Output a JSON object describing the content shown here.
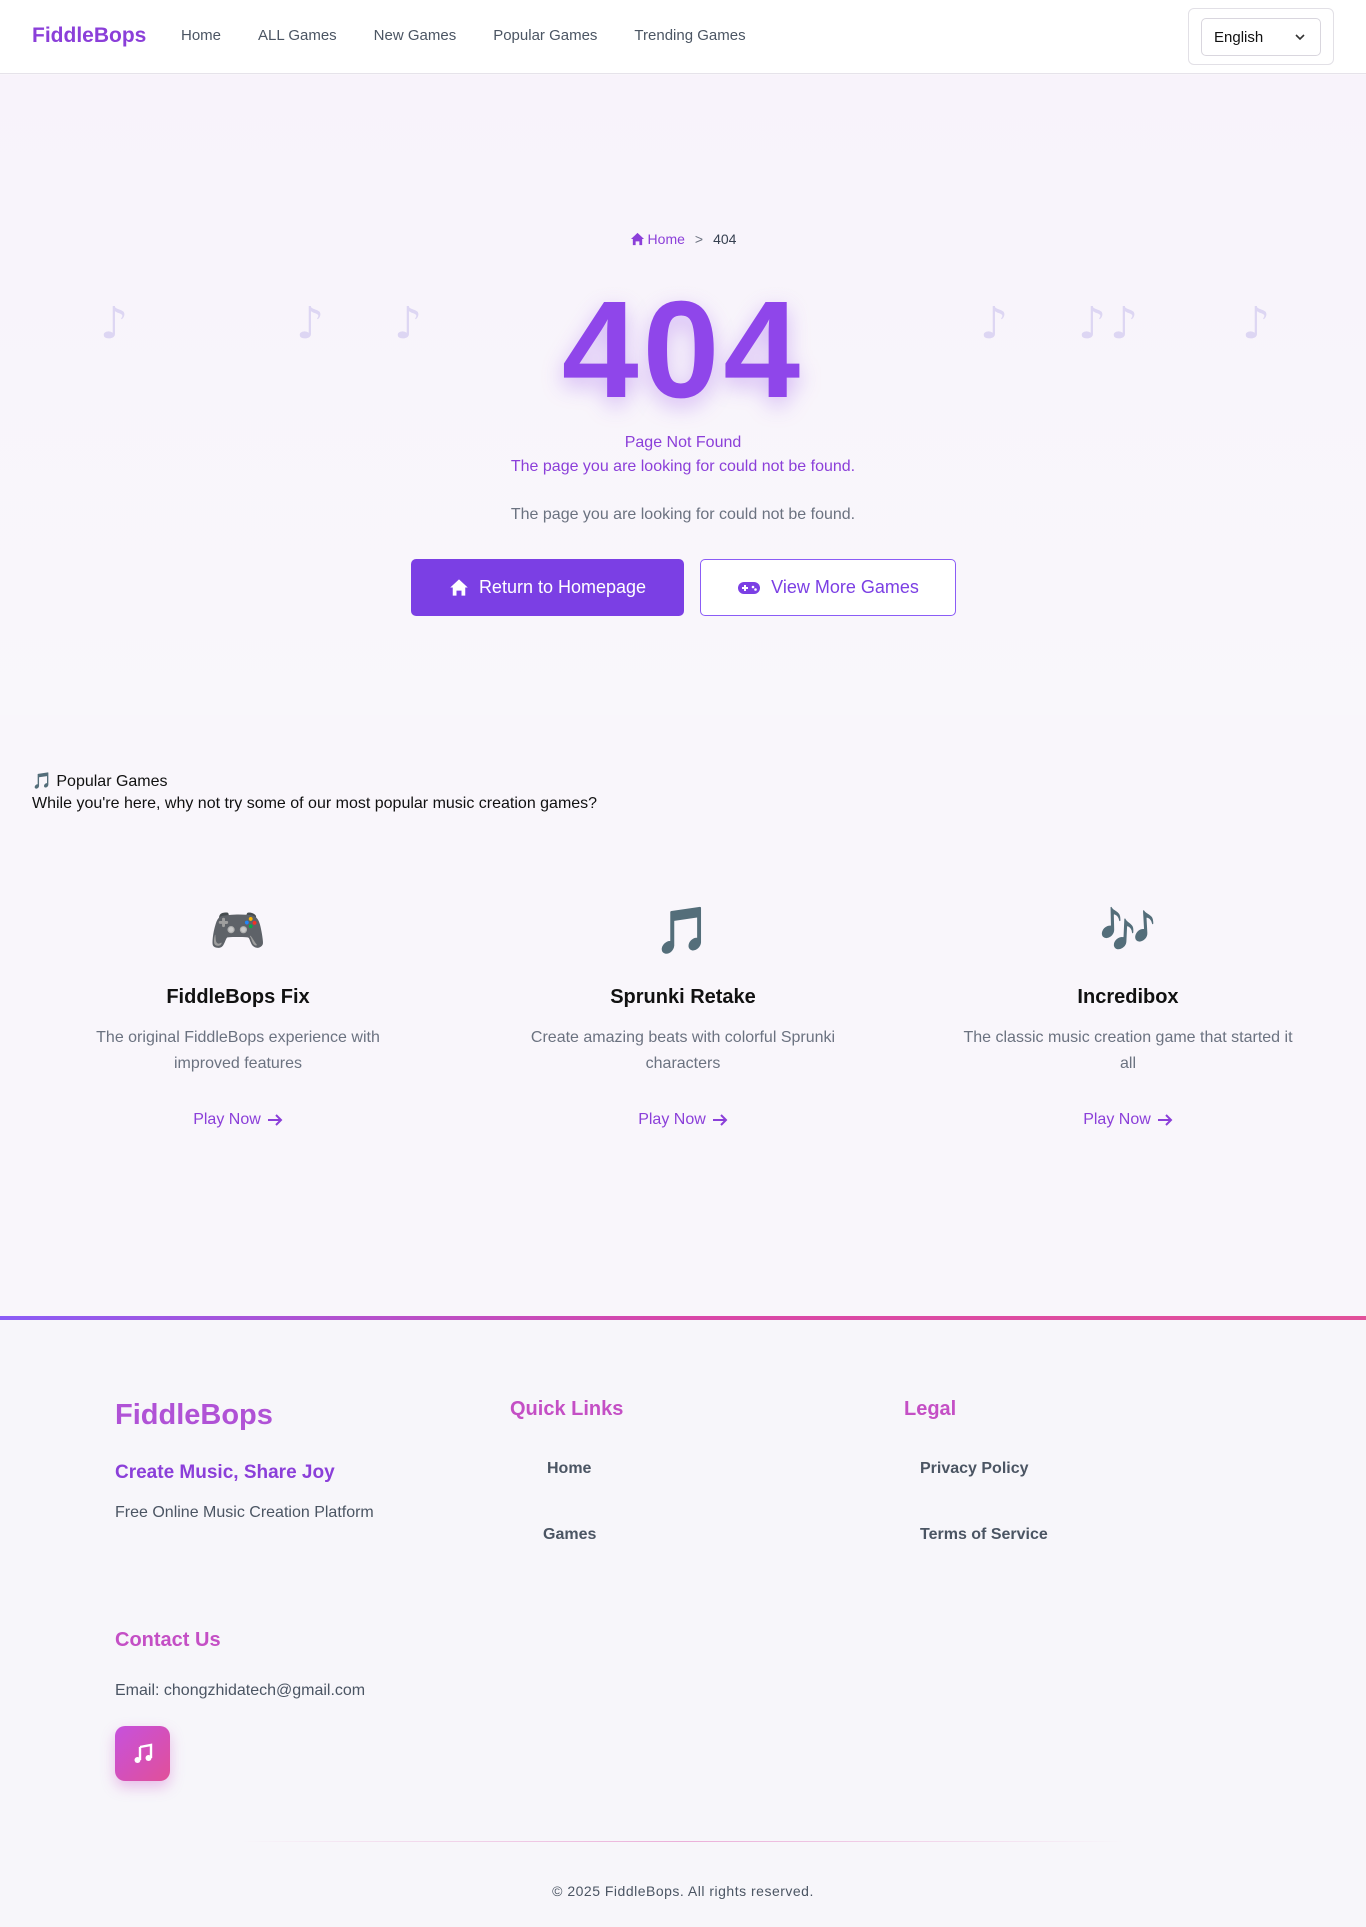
{
  "header": {
    "logo": "FiddleBops",
    "nav": [
      "Home",
      "ALL Games",
      "New Games",
      "Popular Games",
      "Trending Games"
    ],
    "language": "English"
  },
  "hero": {
    "breadcrumb_home": "Home",
    "breadcrumb_sep": ">",
    "breadcrumb_current": "404",
    "code": "404",
    "title": "Page Not Found",
    "subtitle": "The page you are looking for could not be found.",
    "description": "The page you are looking for could not be found.",
    "primary_button": "Return to Homepage",
    "secondary_button": "View More Games",
    "note_glyph": "♪"
  },
  "popular": {
    "title": "🎵 Popular Games",
    "description": "While you're here, why not try some of our most popular music creation games?",
    "games": [
      {
        "icon": "🎮",
        "title": "FiddleBops Fix",
        "desc": "The original FiddleBops experience with improved features",
        "play": "Play Now"
      },
      {
        "icon": "🎵",
        "title": "Sprunki Retake",
        "desc": "Create amazing beats with colorful Sprunki characters",
        "play": "Play Now"
      },
      {
        "icon": "🎶",
        "title": "Incredibox",
        "desc": "The classic music creation game that started it all",
        "play": "Play Now"
      }
    ]
  },
  "footer": {
    "logo": "FiddleBops",
    "tagline": "Create Music, Share Joy",
    "desc": "Free Online Music Creation Platform",
    "quick_links_title": "Quick Links",
    "quick_links": [
      "Home",
      "Games"
    ],
    "legal_title": "Legal",
    "legal_links": [
      "Privacy Policy",
      "Terms of Service"
    ],
    "contact_title": "Contact Us",
    "email": "Email: chongzhidatech@gmail.com",
    "copyright": "© 2025 FiddleBops. All rights reserved."
  },
  "colors": {
    "accent": "#7b3fe4",
    "brand": "#8b3fd9",
    "footer_heading": "#c44fc5"
  }
}
